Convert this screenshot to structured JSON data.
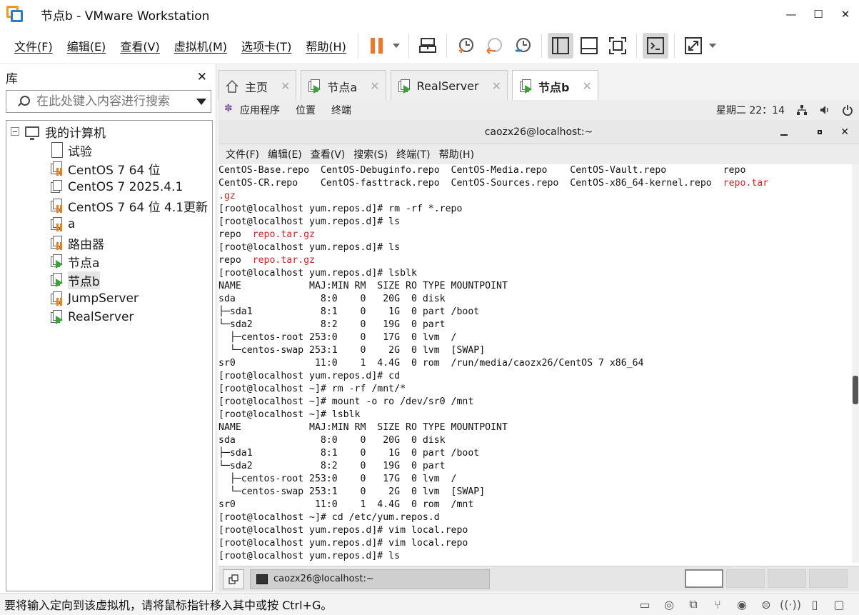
{
  "window": {
    "title": "节点b - VMware Workstation",
    "minimize": "—",
    "maximize": "☐",
    "close": "✕"
  },
  "menu": {
    "items": [
      "文件(F)",
      "编辑(E)",
      "查看(V)",
      "虚拟机(M)",
      "选项卡(T)",
      "帮助(H)"
    ]
  },
  "toolbar": {
    "pause_icon": "pause-icon",
    "accent": "#f0772a"
  },
  "library": {
    "title": "库",
    "close": "✕",
    "search_placeholder": "在此处键入内容进行搜索",
    "root": "我的计算机",
    "items": [
      {
        "label": "试验",
        "icon": "doc"
      },
      {
        "label": "CentOS 7 64 位",
        "icon": "vm-off"
      },
      {
        "label": "CentOS 7 2025.4.1",
        "icon": "vm-plain"
      },
      {
        "label": "CentOS 7 64 位 4.1更新",
        "icon": "vm-off"
      },
      {
        "label": "a",
        "icon": "vm-off"
      },
      {
        "label": "路由器",
        "icon": "vm-off"
      },
      {
        "label": "节点a",
        "icon": "vm-on"
      },
      {
        "label": "节点b",
        "icon": "vm-on"
      },
      {
        "label": "JumpServer",
        "icon": "vm-off"
      },
      {
        "label": "RealServer",
        "icon": "vm-on"
      }
    ],
    "selected": "节点b"
  },
  "tabs": [
    {
      "label": "主页",
      "icon": "home-icon"
    },
    {
      "label": "节点a",
      "icon": "vm-on"
    },
    {
      "label": "RealServer",
      "icon": "vm-on"
    },
    {
      "label": "节点b",
      "icon": "vm-on",
      "active": true
    }
  ],
  "gnome": {
    "apps": "应用程序",
    "places": "位置",
    "terminal": "终端",
    "clock": "星期二 22：14"
  },
  "terminal": {
    "title": "caozx26@localhost:~",
    "menu": [
      "文件(F)",
      "编辑(E)",
      "查看(V)",
      "搜索(S)",
      "终端(T)",
      "帮助(H)"
    ],
    "lines": [
      [
        {
          "t": "CentOS-Base.repo  CentOS-Debuginfo.repo  CentOS-Media.repo    CentOS-Vault.repo          repo"
        }
      ],
      [
        {
          "t": "CentOS-CR.repo    CentOS-fasttrack.repo  CentOS-Sources.repo  CentOS-x86_64-kernel.repo  "
        },
        {
          "t": "repo.tar",
          "c": "red"
        }
      ],
      [
        {
          "t": ".gz",
          "c": "red"
        }
      ],
      [
        {
          "t": "[root@localhost yum.repos.d]# rm -rf *.repo"
        }
      ],
      [
        {
          "t": "[root@localhost yum.repos.d]# ls"
        }
      ],
      [
        {
          "t": "repo  "
        },
        {
          "t": "repo.tar.gz",
          "c": "red"
        }
      ],
      [
        {
          "t": "[root@localhost yum.repos.d]# ls"
        }
      ],
      [
        {
          "t": "repo  "
        },
        {
          "t": "repo.tar.gz",
          "c": "red"
        }
      ],
      [
        {
          "t": "[root@localhost yum.repos.d]# lsblk"
        }
      ],
      [
        {
          "t": "NAME            MAJ:MIN RM  SIZE RO TYPE MOUNTPOINT"
        }
      ],
      [
        {
          "t": "sda               8:0    0   20G  0 disk"
        }
      ],
      [
        {
          "t": "├─sda1            8:1    0    1G  0 part /boot"
        }
      ],
      [
        {
          "t": "└─sda2            8:2    0   19G  0 part"
        }
      ],
      [
        {
          "t": "  ├─centos-root 253:0    0   17G  0 lvm  /"
        }
      ],
      [
        {
          "t": "  └─centos-swap 253:1    0    2G  0 lvm  [SWAP]"
        }
      ],
      [
        {
          "t": "sr0              11:0    1  4.4G  0 rom  /run/media/caozx26/CentOS 7 x86_64"
        }
      ],
      [
        {
          "t": "[root@localhost yum.repos.d]# cd"
        }
      ],
      [
        {
          "t": "[root@localhost ~]# rm -rf /mnt/*"
        }
      ],
      [
        {
          "t": "[root@localhost ~]# mount -o ro /dev/sr0 /mnt"
        }
      ],
      [
        {
          "t": "[root@localhost ~]# lsblk"
        }
      ],
      [
        {
          "t": "NAME            MAJ:MIN RM  SIZE RO TYPE MOUNTPOINT"
        }
      ],
      [
        {
          "t": "sda               8:0    0   20G  0 disk"
        }
      ],
      [
        {
          "t": "├─sda1            8:1    0    1G  0 part /boot"
        }
      ],
      [
        {
          "t": "└─sda2            8:2    0   19G  0 part"
        }
      ],
      [
        {
          "t": "  ├─centos-root 253:0    0   17G  0 lvm  /"
        }
      ],
      [
        {
          "t": "  └─centos-swap 253:1    0    2G  0 lvm  [SWAP]"
        }
      ],
      [
        {
          "t": "sr0              11:0    1  4.4G  0 rom  /mnt"
        }
      ],
      [
        {
          "t": "[root@localhost ~]# cd /etc/yum.repos.d"
        }
      ],
      [
        {
          "t": "[root@localhost yum.repos.d]# vim local.repo"
        }
      ],
      [
        {
          "t": "[root@localhost yum.repos.d]# vim local.repo"
        }
      ],
      [
        {
          "t": "[root@localhost yum.repos.d]# ls"
        }
      ]
    ]
  },
  "taskbar": {
    "window_label": "caozx26@localhost:~"
  },
  "status": {
    "text": "要将输入定向到该虚拟机，请将鼠标指针移入其中或按 Ctrl+G。"
  }
}
